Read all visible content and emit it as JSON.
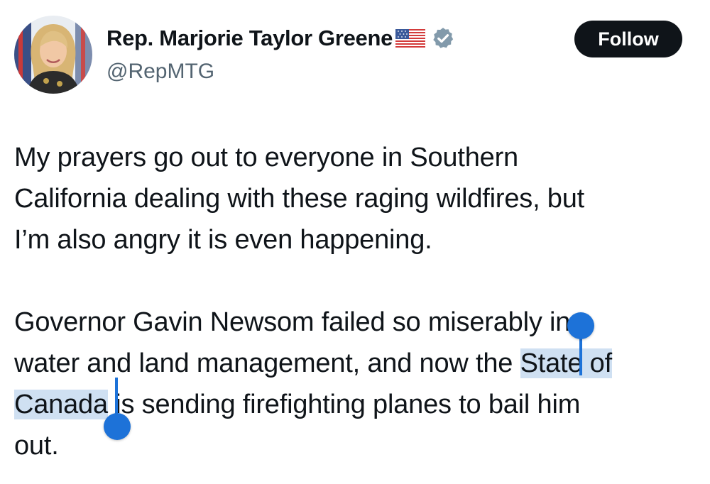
{
  "author": {
    "display_name": "Rep. Marjorie Taylor Greene",
    "handle": "@RepMTG",
    "flag_icon": "us-flag-icon",
    "badge_icon": "verified-badge-icon",
    "badge_color": "#829aab"
  },
  "follow_button": {
    "label": "Follow"
  },
  "tweet": {
    "paragraph1": {
      "line1": "My prayers go out to everyone in Southern",
      "line2": "California dealing with these raging wildfires, but",
      "line3": "I’m also angry it is even happening."
    },
    "paragraph2": {
      "line1": "Governor Gavin Newsom failed so miserably in",
      "line2_before": "water and land management, and now the ",
      "selection_part1": "State of",
      "selection_part2": "Canada",
      "line3_after": " is sending firefighting planes to bail him",
      "line4": "out."
    }
  },
  "selection": {
    "color": "#cfe0f2",
    "handle_color": "#1d72d8"
  }
}
